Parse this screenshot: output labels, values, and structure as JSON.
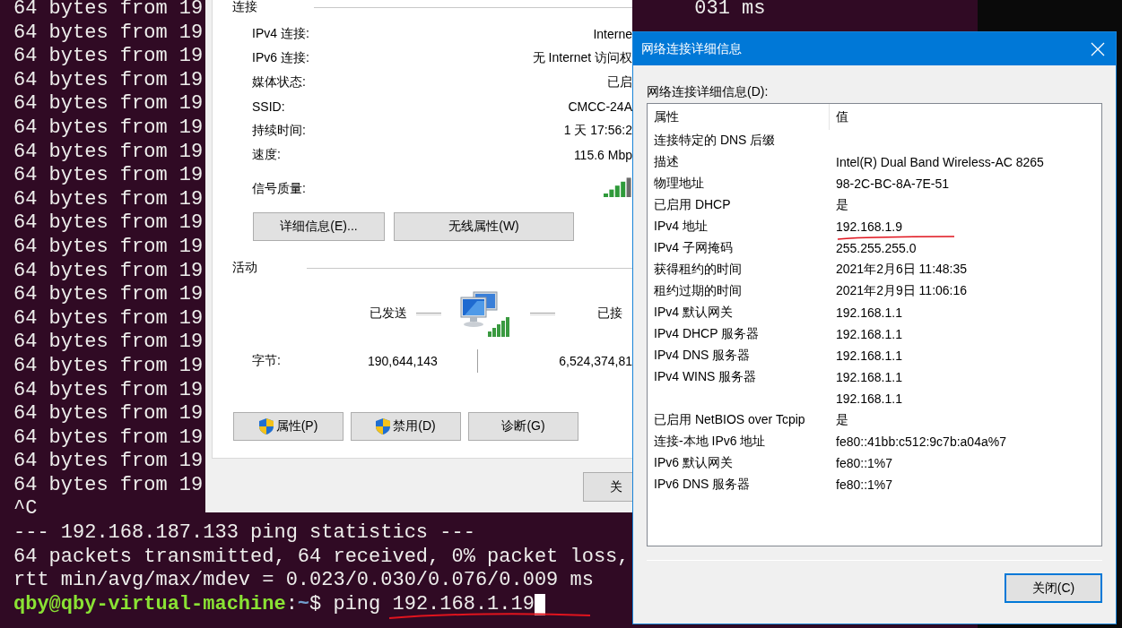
{
  "terminal": {
    "lines": [
      {
        "kind": "output",
        "text": "64 bytes from 19",
        "tail": "031 ms"
      },
      {
        "kind": "output",
        "text": "64 bytes from 19"
      },
      {
        "kind": "output",
        "text": "64 bytes from 19"
      },
      {
        "kind": "output",
        "text": "64 bytes from 19"
      },
      {
        "kind": "output",
        "text": "64 bytes from 19"
      },
      {
        "kind": "output",
        "text": "64 bytes from 19"
      },
      {
        "kind": "output",
        "text": "64 bytes from 19"
      },
      {
        "kind": "output",
        "text": "64 bytes from 19"
      },
      {
        "kind": "output",
        "text": "64 bytes from 19"
      },
      {
        "kind": "output",
        "text": "64 bytes from 19"
      },
      {
        "kind": "output",
        "text": "64 bytes from 19"
      },
      {
        "kind": "output",
        "text": "64 bytes from 19"
      },
      {
        "kind": "output",
        "text": "64 bytes from 19"
      },
      {
        "kind": "output",
        "text": "64 bytes from 19"
      },
      {
        "kind": "output",
        "text": "64 bytes from 19"
      },
      {
        "kind": "output",
        "text": "64 bytes from 19"
      },
      {
        "kind": "output",
        "text": "64 bytes from 19"
      },
      {
        "kind": "output",
        "text": "64 bytes from 19"
      },
      {
        "kind": "output",
        "text": "64 bytes from 19"
      },
      {
        "kind": "output",
        "text": "64 bytes from 19"
      },
      {
        "kind": "output",
        "text": "64 bytes from 19"
      },
      {
        "kind": "output",
        "text": "^C"
      },
      {
        "kind": "output",
        "text": "--- 192.168.187.133 ping statistics ---"
      },
      {
        "kind": "output",
        "text": "64 packets transmitted, 64 received, 0% packet loss,"
      },
      {
        "kind": "output",
        "text": "rtt min/avg/max/mdev = 0.023/0.030/0.076/0.009 ms"
      },
      {
        "kind": "prompt",
        "user": "qby@qby-virtual-machine",
        "colon": ":",
        "path": "~",
        "symbol": "$",
        "command": "ping",
        "argument": "192.168.1.19",
        "underlined": true
      }
    ]
  },
  "status_window": {
    "connection": {
      "title": "连接",
      "rows": [
        {
          "label": "IPv4 连接:",
          "value": "Interne"
        },
        {
          "label": "IPv6 连接:",
          "value": "无 Internet 访问权"
        },
        {
          "label": "媒体状态:",
          "value": "已启"
        },
        {
          "label": "SSID:",
          "value": "CMCC-24A"
        },
        {
          "label": "持续时间:",
          "value": "1 天 17:56:2"
        },
        {
          "label": "速度:",
          "value": "115.6 Mbp"
        }
      ],
      "signal_label": "信号质量:"
    },
    "buttons": [
      {
        "label": "详细信息(E)..."
      },
      {
        "label": "无线属性(W)"
      }
    ],
    "activity": {
      "title": "活动",
      "sent_label": "已发送",
      "received_label": "已接",
      "bytes_label": "字节:",
      "bytes_sent": "190,644,143",
      "bytes_received": "6,524,374,81"
    },
    "action_buttons": [
      {
        "label": "属性(P)",
        "shield": true
      },
      {
        "label": "禁用(D)",
        "shield": true
      },
      {
        "label": "诊断(G)",
        "shield": false
      }
    ],
    "close_button": "关"
  },
  "details_window": {
    "title": "网络连接详细信息",
    "list_label": "网络连接详细信息(D):",
    "columns": [
      "属性",
      "值"
    ],
    "rows": [
      {
        "property": "连接特定的 DNS 后缀"
      },
      {
        "property": "描述",
        "value": "Intel(R) Dual Band Wireless-AC 8265"
      },
      {
        "property": "物理地址",
        "value": "98-2C-BC-8A-7E-51"
      },
      {
        "property": "已启用 DHCP",
        "value": "是"
      },
      {
        "property": "IPv4 地址",
        "value": "192.168.1.9",
        "underlined": true
      },
      {
        "property": "IPv4 子网掩码",
        "value": "255.255.255.0"
      },
      {
        "property": "获得租约的时间",
        "value": "2021年2月6日 11:48:35"
      },
      {
        "property": "租约过期的时间",
        "value": "2021年2月9日 11:06:16"
      },
      {
        "property": "IPv4 默认网关",
        "value": "192.168.1.1"
      },
      {
        "property": "IPv4 DHCP 服务器",
        "value": "192.168.1.1"
      },
      {
        "property": "IPv4 DNS 服务器",
        "value": "192.168.1.1"
      },
      {
        "property": "IPv4 WINS 服务器",
        "value": "192.168.1.1"
      },
      {
        "value": "192.168.1.1"
      },
      {
        "property": "已启用 NetBIOS over Tcpip",
        "value": "是"
      },
      {
        "property": "连接-本地 IPv6 地址",
        "value": "fe80::41bb:c512:9c7b:a04a%7"
      },
      {
        "property": "IPv6 默认网关",
        "value": "fe80::1%7"
      },
      {
        "property": "IPv6 DNS 服务器",
        "value": "fe80::1%7"
      }
    ],
    "close_button": "关闭(C)"
  }
}
